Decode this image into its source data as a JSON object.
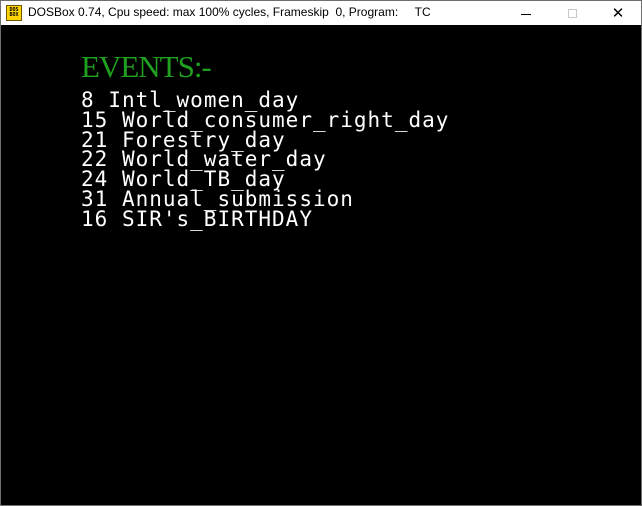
{
  "window": {
    "title": "DOSBox 0.74, Cpu speed: max 100% cycles, Frameskip  0, Program:     TC",
    "icon_name": "dosbox-icon",
    "icon_text": "DOS BOX",
    "controls": {
      "minimize": "minimize-icon",
      "maximize": "maximize-icon",
      "close": "close-icon",
      "close_glyph": "✕"
    }
  },
  "screen": {
    "background": "#000000",
    "heading": "EVENTS:-",
    "heading_color": "#1fa01f",
    "text_color": "#ffffff",
    "events": [
      {
        "day": "8",
        "name": "Intl_women_day"
      },
      {
        "day": "15",
        "name": "World_consumer_right_day"
      },
      {
        "day": "21",
        "name": "Forestry_day"
      },
      {
        "day": "22",
        "name": "World_water_day"
      },
      {
        "day": "24",
        "name": "World_TB_day"
      },
      {
        "day": "31",
        "name": "Annual_submission"
      },
      {
        "day": "16",
        "name": "SIR's_BIRTHDAY"
      }
    ]
  }
}
